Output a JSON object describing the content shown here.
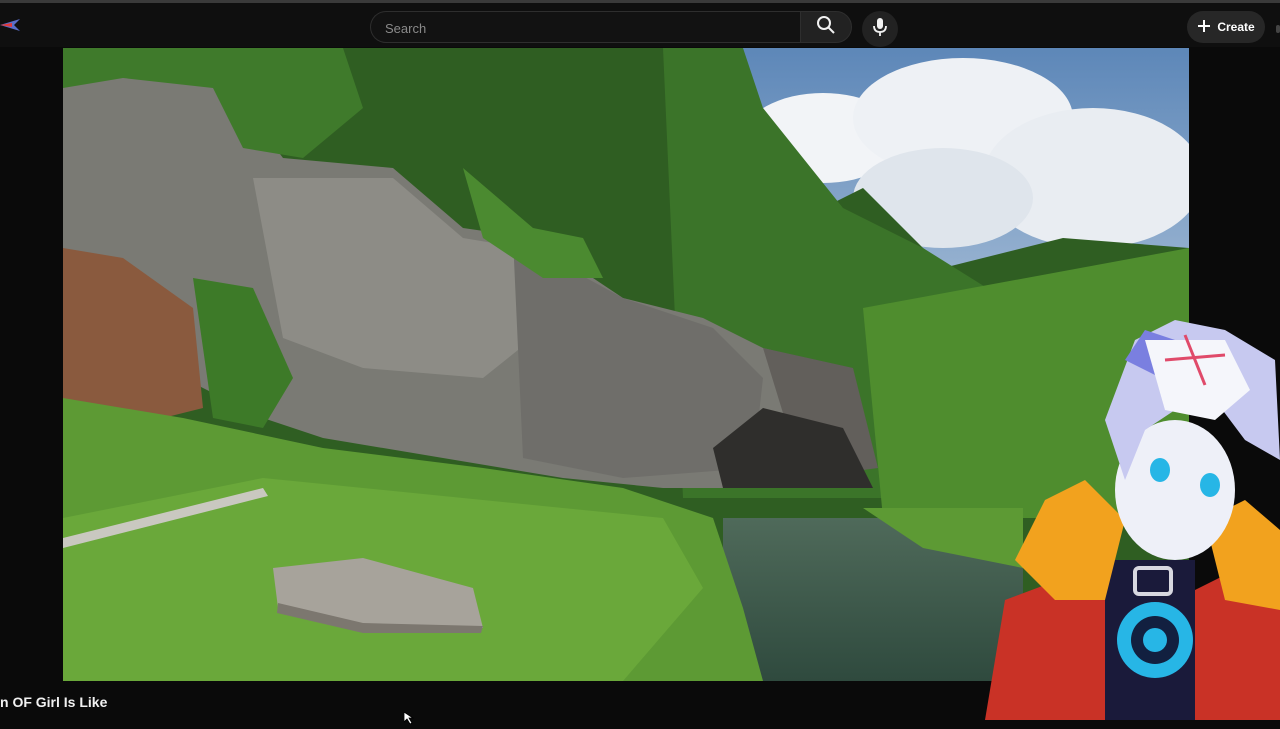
{
  "header": {
    "search": {
      "placeholder": "Search",
      "value": ""
    },
    "create_label": "Create",
    "icons": {
      "logo": "app-logo-icon",
      "search": "search-icon",
      "mic": "mic-icon",
      "create": "plus-icon"
    }
  },
  "video": {
    "description": "player-frame"
  },
  "below_video": {
    "title": "n OF Girl Is Like"
  },
  "colors": {
    "page_bg": "#0a0a0a",
    "topbar_bg": "#0f0f0f",
    "button_bg": "#272727"
  }
}
